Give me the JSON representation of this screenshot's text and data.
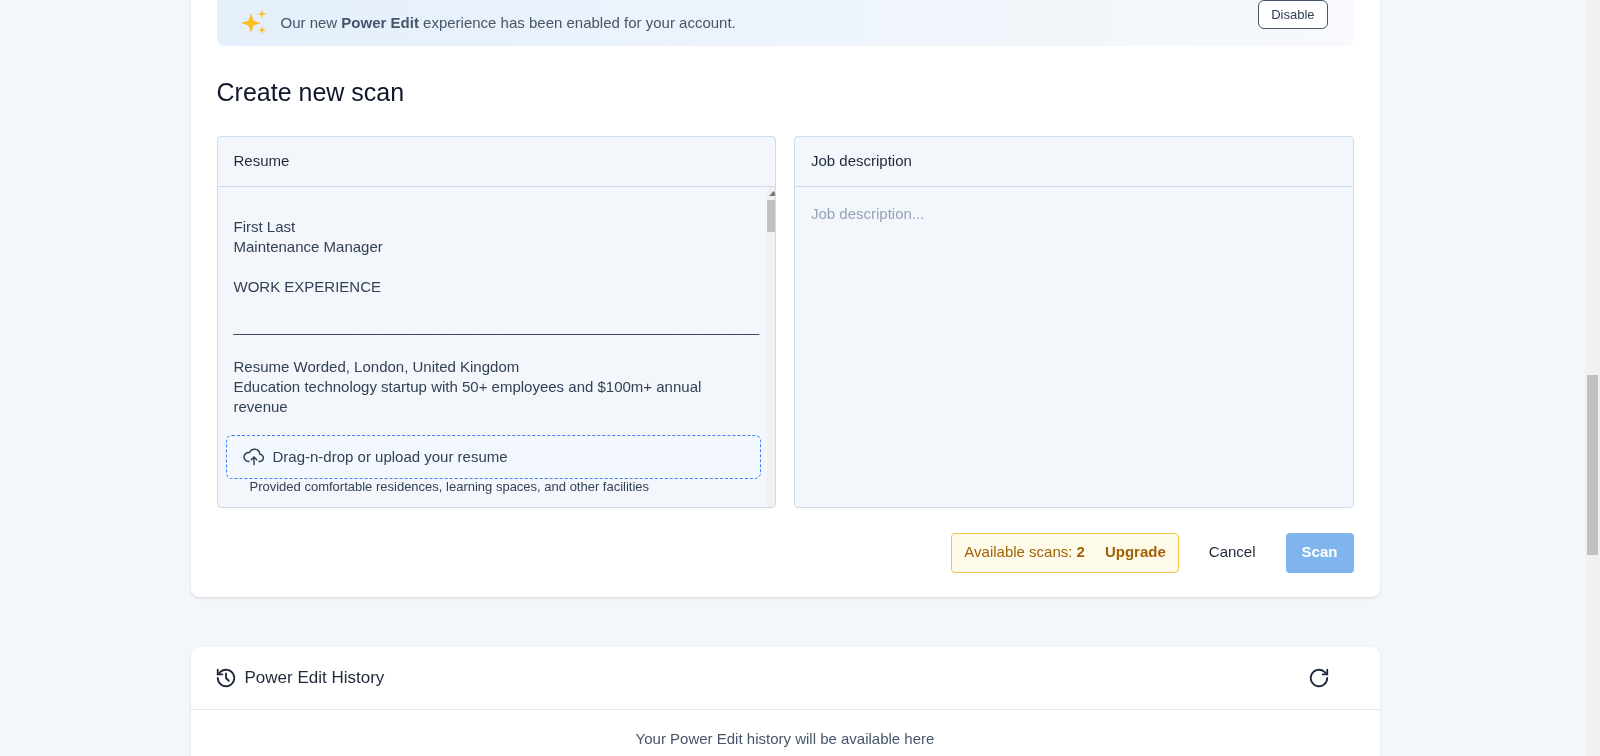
{
  "banner": {
    "message": "Our new **Power Edit** experience has been enabled for your account.",
    "button": "Disable"
  },
  "heading": "Create new scan",
  "resume": {
    "title": "Resume",
    "paragraphs": [
      [
        "First Last",
        "Maintenance Manager"
      ],
      [
        "WORK EXPERIENCE"
      ],
      [
        "_______________________________________________________________"
      ],
      [
        "Resume Worded, London, United Kingdom",
        "Education technology startup with 50+ employees and $100m+ annual revenue"
      ]
    ],
    "upload": "Drag-n-drop or upload your resume",
    "bullet": "Provided comfortable residences, learning spaces, and other facilities"
  },
  "job": {
    "title": "Job description",
    "placeholder": "Job description..."
  },
  "actions": {
    "scans_label": "Available scans:",
    "scans_count": "2",
    "upgrade": "Upgrade",
    "cancel": "Cancel",
    "scan": {
      "label": "Scan",
      "disabled": true
    }
  },
  "history": {
    "title": "Power Edit History",
    "empty": "Your Power Edit history will be available here"
  }
}
